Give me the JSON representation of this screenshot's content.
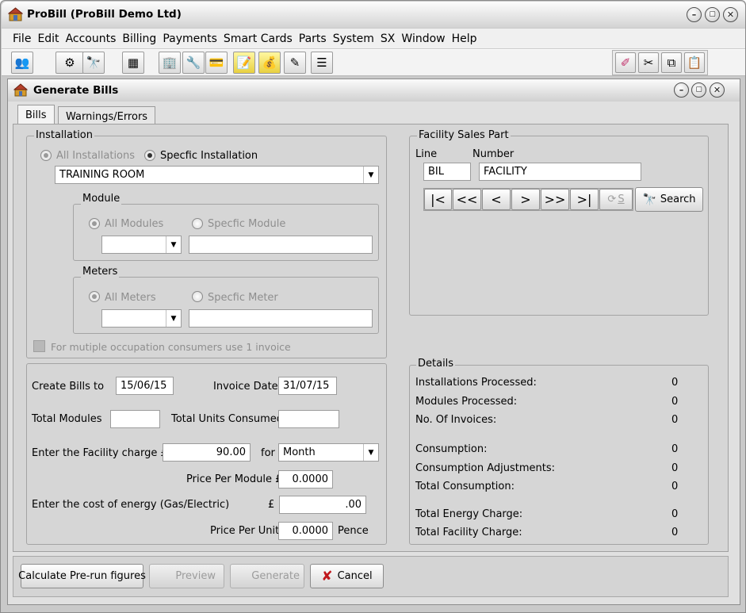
{
  "app": {
    "title": "ProBill (ProBill Demo Ltd)"
  },
  "menu": [
    "File",
    "Edit",
    "Accounts",
    "Billing",
    "Payments",
    "Smart Cards",
    "Parts",
    "System",
    "SX",
    "Window",
    "Help"
  ],
  "child": {
    "title": "Generate Bills"
  },
  "tabs": [
    "Bills",
    "Warnings/Errors"
  ],
  "installation": {
    "group_label": "Installation",
    "all_label": "All Installations",
    "specific_label": "Specfic Installation",
    "selected": "TRAINING ROOM",
    "module": {
      "group_label": "Module",
      "all_label": "All Modules",
      "specific_label": "Specfic Module",
      "combo_value": "",
      "text_value": ""
    },
    "meters": {
      "group_label": "Meters",
      "all_label": "All Meters",
      "specific_label": "Specfic Meter",
      "combo_value": "",
      "text_value": ""
    },
    "multi_occ_label": "For mutiple occupation consumers use 1 invoice"
  },
  "facility": {
    "group_label": "Facility Sales Part",
    "line_label": "Line",
    "number_label": "Number",
    "line_value": "BIL",
    "number_value": "FACILITY",
    "nav": [
      "|<",
      "<<",
      "<",
      ">",
      ">>",
      ">|"
    ],
    "refresh_label": "S",
    "search_label": "Search"
  },
  "billing": {
    "create_label": "Create Bills to",
    "create_value": "15/06/15",
    "invoice_date_label": "Invoice Date",
    "invoice_date_value": "31/07/15",
    "total_modules_label": "Total Modules",
    "total_modules_value": "",
    "total_units_label": "Total Units Consumed",
    "total_units_value": "",
    "facility_charge_label": "Enter the Facility charge £",
    "facility_charge_value": "90.00",
    "for_label": "for",
    "period_value": "Month",
    "ppm_label": "Price Per Module £",
    "ppm_value": "0.0000",
    "energy_label": "Enter the cost of energy (Gas/Electric)",
    "pound": "£",
    "energy_value": ".00",
    "ppu_label": "Price Per Unit",
    "ppu_value": "0.0000",
    "pence_label": "Pence"
  },
  "details": {
    "group_label": "Details",
    "rows": [
      {
        "label": "Installations Processed:",
        "value": "0"
      },
      {
        "label": "Modules Processed:",
        "value": "0"
      },
      {
        "label": "No. Of Invoices:",
        "value": "0"
      },
      {
        "label": "Consumption:",
        "value": "0"
      },
      {
        "label": "Consumption Adjustments:",
        "value": "0"
      },
      {
        "label": "Total Consumption:",
        "value": "0"
      },
      {
        "label": "Total Energy Charge:",
        "value": "0"
      },
      {
        "label": "Total Facility Charge:",
        "value": "0"
      }
    ]
  },
  "buttons": {
    "calculate": "Calculate Pre-run figures",
    "preview": "Preview",
    "generate": "Generate",
    "cancel": "Cancel"
  },
  "colors": {
    "cancel_x": "#c0161b",
    "title_text": "#1a1a1a"
  }
}
